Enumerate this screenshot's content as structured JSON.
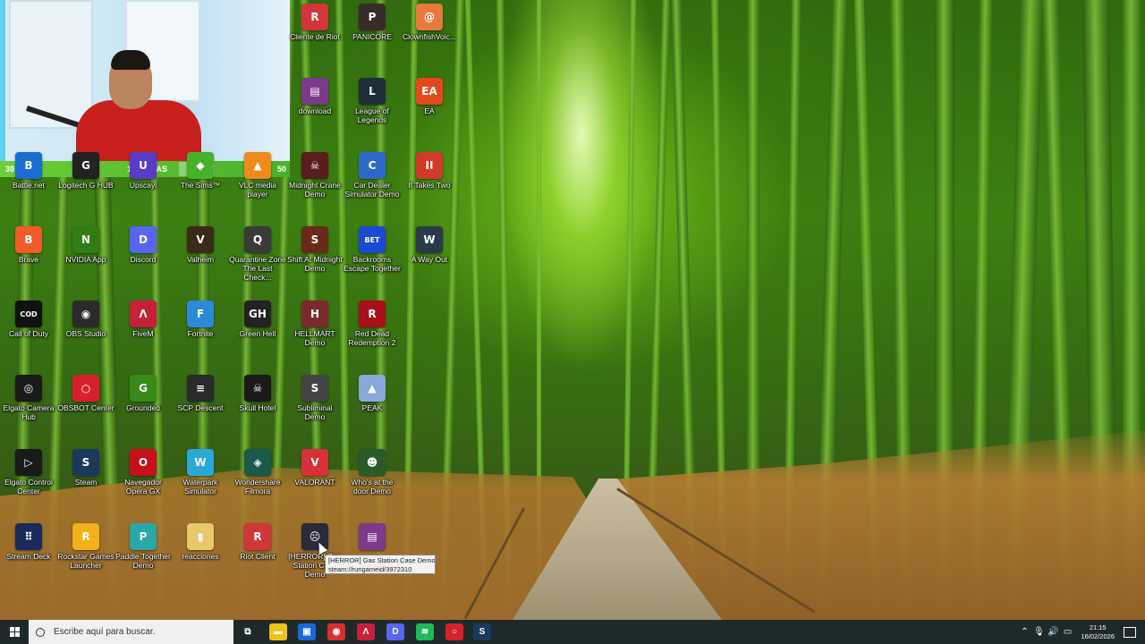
{
  "webcam": {
    "left_number": "30",
    "hours_text": "12 HORAS",
    "right_number": "50"
  },
  "icons": [
    {
      "label": "Cliente de Riot",
      "icon": "riot-client-icon",
      "color": "#d13639",
      "glyph": "R"
    },
    {
      "label": "PANICORE",
      "icon": "panicore-icon",
      "color": "#3a2a2a",
      "glyph": "P"
    },
    {
      "label": "ClownfishVoic...",
      "icon": "clownfish-icon",
      "color": "#e77a3c",
      "glyph": "@"
    },
    {
      "label": "download",
      "icon": "winrar-icon",
      "color": "#7b3a8a",
      "glyph": "▤"
    },
    {
      "label": "League of Legends",
      "icon": "lol-icon",
      "color": "#1e2f3a",
      "glyph": "L"
    },
    {
      "label": "EA",
      "icon": "ea-icon",
      "color": "#e24a1d",
      "glyph": "EA"
    },
    {
      "label": "Battle.net",
      "icon": "battlenet-icon",
      "color": "#1a6dd1",
      "glyph": "B"
    },
    {
      "label": "Logitech G HUB",
      "icon": "logitech-icon",
      "color": "#222",
      "glyph": "G"
    },
    {
      "label": "Upscayl",
      "icon": "upscayl-icon",
      "color": "#5a3ac8",
      "glyph": "U"
    },
    {
      "label": "The Sims™",
      "icon": "sims-icon",
      "color": "#49b02a",
      "glyph": "◆"
    },
    {
      "label": "VLC media player",
      "icon": "vlc-icon",
      "color": "#f08a1a",
      "glyph": "▲"
    },
    {
      "label": "Midnight Crane Demo",
      "icon": "midnight-crane-icon",
      "color": "#5a1d1d",
      "glyph": "☠"
    },
    {
      "label": "Car Dealer Simulator Demo",
      "icon": "car-dealer-icon",
      "color": "#2d6ac8",
      "glyph": "C"
    },
    {
      "label": "It Takes Two",
      "icon": "it-takes-two-icon",
      "color": "#d13a2a",
      "glyph": "II"
    },
    {
      "label": "Brave",
      "icon": "brave-icon",
      "color": "#f25a2a",
      "glyph": "B"
    },
    {
      "label": "NVIDIA App",
      "icon": "nvidia-icon",
      "color": "#2f7d14",
      "glyph": "N"
    },
    {
      "label": "Discord",
      "icon": "discord-icon",
      "color": "#5865f2",
      "glyph": "D"
    },
    {
      "label": "Valheim",
      "icon": "valheim-icon",
      "color": "#3a2a1a",
      "glyph": "V"
    },
    {
      "label": "Quarantine Zone The Last Check...",
      "icon": "quarantine-zone-icon",
      "color": "#3a3a3a",
      "glyph": "Q"
    },
    {
      "label": "Shift At Midnight Demo",
      "icon": "shift-at-midnight-icon",
      "color": "#6a2a1a",
      "glyph": "S"
    },
    {
      "label": "Backrooms Escape Together",
      "icon": "backrooms-icon",
      "color": "#1a4ad1",
      "glyph": "BET"
    },
    {
      "label": "A Way Out",
      "icon": "a-way-out-icon",
      "color": "#2a3a4a",
      "glyph": "W"
    },
    {
      "label": "Call of Duty",
      "icon": "cod-icon",
      "color": "#111",
      "glyph": "COD"
    },
    {
      "label": "OBS Studio",
      "icon": "obs-icon",
      "color": "#2a2a2a",
      "glyph": "◉"
    },
    {
      "label": "FiveM",
      "icon": "fivem-icon",
      "color": "#c8203a",
      "glyph": "Λ"
    },
    {
      "label": "Fortnite",
      "icon": "fortnite-icon",
      "color": "#2a8ad8",
      "glyph": "F"
    },
    {
      "label": "Green Hell",
      "icon": "green-hell-icon",
      "color": "#222",
      "glyph": "GH"
    },
    {
      "label": "HELLMART Demo",
      "icon": "hellmart-icon",
      "color": "#7a2a2a",
      "glyph": "H"
    },
    {
      "label": "Red Dead Redemption 2",
      "icon": "rdr2-icon",
      "color": "#a8101a",
      "glyph": "R"
    },
    {
      "label": "Elgato Camera Hub",
      "icon": "elgato-camera-icon",
      "color": "#1a1a1a",
      "glyph": "◎"
    },
    {
      "label": "OBSBOT Center",
      "icon": "obsbot-icon",
      "color": "#d8202a",
      "glyph": "○"
    },
    {
      "label": "Grounded",
      "icon": "grounded-icon",
      "color": "#3a8a1a",
      "glyph": "G"
    },
    {
      "label": "SCP Descent",
      "icon": "scp-descent-icon",
      "color": "#2a2a2a",
      "glyph": "≡"
    },
    {
      "label": "Skull Hotel",
      "icon": "skull-hotel-icon",
      "color": "#1a1a1a",
      "glyph": "☠"
    },
    {
      "label": "Subliminal Demo",
      "icon": "subliminal-icon",
      "color": "#444",
      "glyph": "S"
    },
    {
      "label": "PEAK",
      "icon": "peak-icon",
      "color": "#8aa8d8",
      "glyph": "▲"
    },
    {
      "label": "Elgato Control Center",
      "icon": "elgato-control-icon",
      "color": "#1a1a1a",
      "glyph": "▷"
    },
    {
      "label": "Steam",
      "icon": "steam-icon",
      "color": "#1b3a5a",
      "glyph": "S"
    },
    {
      "label": "Navegador Opera GX",
      "icon": "opera-gx-icon",
      "color": "#c8101a",
      "glyph": "O"
    },
    {
      "label": "Waterpark Simulator",
      "icon": "waterpark-icon",
      "color": "#2aa8d8",
      "glyph": "W"
    },
    {
      "label": "Wondershare Filmora",
      "icon": "filmora-icon",
      "color": "#1a5a4a",
      "glyph": "◈"
    },
    {
      "label": "VALORANT",
      "icon": "valorant-icon",
      "color": "#d8303a",
      "glyph": "V"
    },
    {
      "label": "Who's at the door Demo",
      "icon": "whos-at-the-door-icon",
      "color": "#2a5a2a",
      "glyph": "☻"
    },
    {
      "label": "Stream Deck",
      "icon": "stream-deck-icon",
      "color": "#1a2a5a",
      "glyph": "⠿"
    },
    {
      "label": "Rockstar Games Launcher",
      "icon": "rockstar-icon",
      "color": "#f2b01a",
      "glyph": "R"
    },
    {
      "label": "Paddle Together Demo",
      "icon": "paddle-together-icon",
      "color": "#2aa8a8",
      "glyph": "P"
    },
    {
      "label": "reacciones",
      "icon": "folder-icon",
      "color": "#e8c86a",
      "glyph": "▮"
    },
    {
      "label": "Riot Client",
      "icon": "riot-client-2-icon",
      "color": "#d13639",
      "glyph": "R"
    },
    {
      "label": "[HERROR] Gas Station Case Demo",
      "icon": "gas-station-icon",
      "color": "#2a2a3a",
      "glyph": "☹"
    },
    {
      "label": "",
      "icon": "winrar-2-icon",
      "color": "#7b3a8a",
      "glyph": "▤"
    }
  ],
  "tooltip": {
    "line1": "[HERROR] Gas Station Case Demo",
    "line2": "steam://rungameid/3972310"
  },
  "taskbar": {
    "search_placeholder": "Escribe aquí para buscar.",
    "pinned": [
      {
        "icon": "task-view-icon",
        "color": "#1e2a2a",
        "glyph": "⧉"
      },
      {
        "icon": "file-explorer-icon",
        "color": "#f2c01a",
        "glyph": "▬"
      },
      {
        "icon": "store-icon",
        "color": "#1a6ad8",
        "glyph": "▣"
      },
      {
        "icon": "chrome-icon",
        "color": "#d8302a",
        "glyph": "◉"
      },
      {
        "icon": "fivem-taskbar-icon",
        "color": "#c8203a",
        "glyph": "Λ"
      },
      {
        "icon": "discord-taskbar-icon",
        "color": "#5865f2",
        "glyph": "D"
      },
      {
        "icon": "spotify-icon",
        "color": "#1db954",
        "glyph": "≋"
      },
      {
        "icon": "obsbot-taskbar-icon",
        "color": "#d8202a",
        "glyph": "○"
      },
      {
        "icon": "steam-taskbar-icon",
        "color": "#1b3a5a",
        "glyph": "S"
      }
    ],
    "time": "21:15",
    "date": "16/02/2026"
  }
}
